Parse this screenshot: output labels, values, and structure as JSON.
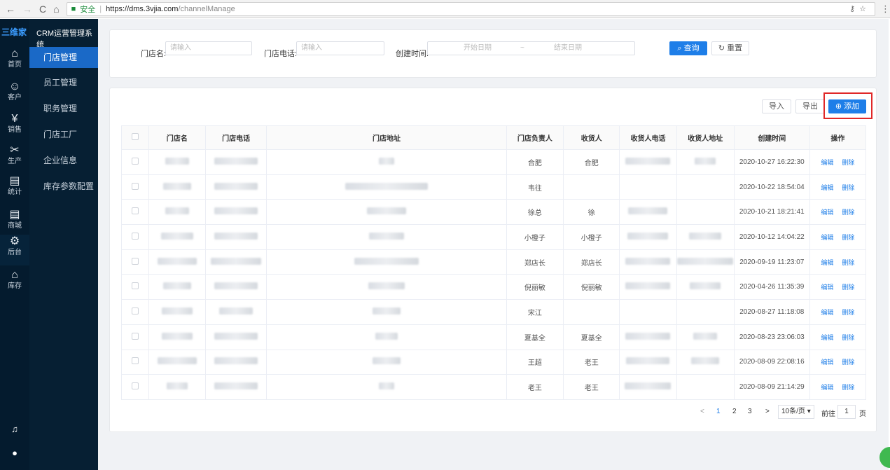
{
  "browser": {
    "secure_label": "安全",
    "url_host": "https://dms.3vjia.com",
    "url_path": "/channelManage"
  },
  "rail": {
    "logo": "三维家",
    "items": [
      {
        "icon": "home-icon",
        "label": "首页"
      },
      {
        "icon": "customer-icon",
        "label": "客户"
      },
      {
        "icon": "sales-icon",
        "label": "销售"
      },
      {
        "icon": "production-icon",
        "label": "生产"
      },
      {
        "icon": "stats-icon",
        "label": "统计"
      },
      {
        "icon": "mall-icon",
        "label": "商城"
      },
      {
        "icon": "backend-icon",
        "label": "后台"
      },
      {
        "icon": "warehouse-icon",
        "label": "库存"
      }
    ]
  },
  "sidebar": {
    "title": "CRM运营管理系统",
    "items": [
      {
        "label": "门店管理"
      },
      {
        "label": "员工管理"
      },
      {
        "label": "职务管理"
      },
      {
        "label": "门店工厂"
      },
      {
        "label": "企业信息"
      },
      {
        "label": "库存参数配置"
      }
    ]
  },
  "filter": {
    "store_name_label": "门店名:",
    "store_name_placeholder": "请输入",
    "store_phone_label": "门店电话:",
    "store_phone_placeholder": "请输入",
    "created_label": "创建时间:",
    "start_placeholder": "开始日期",
    "range_sep": "~",
    "end_placeholder": "结束日期",
    "search_label": "查询",
    "reset_label": "重置"
  },
  "toolbar": {
    "import_label": "导入",
    "export_label": "导出",
    "add_label": "添加"
  },
  "table": {
    "headers": [
      "门店名",
      "门店电话",
      "门店地址",
      "门店负责人",
      "收货人",
      "收货人电话",
      "收货人地址",
      "创建时间",
      "操作"
    ],
    "edit_label": "编辑",
    "delete_label": "删除",
    "rows": [
      {
        "manager": "合肥",
        "receiver": "合肥",
        "created": "2020-10-27 16:22:30"
      },
      {
        "manager": "韦往",
        "receiver": "",
        "created": "2020-10-22 18:54:04"
      },
      {
        "manager": "徐总",
        "receiver": "徐",
        "created": "2020-10-21 18:21:41"
      },
      {
        "manager": "小橙子",
        "receiver": "小橙子",
        "created": "2020-10-12 14:04:22"
      },
      {
        "manager": "郑店长",
        "receiver": "郑店长",
        "created": "2020-09-19 11:23:07"
      },
      {
        "manager": "倪丽敏",
        "receiver": "倪丽敏",
        "created": "2020-04-26 11:35:39"
      },
      {
        "manager": "宋江",
        "receiver": "",
        "created": "2020-08-27 11:18:08"
      },
      {
        "manager": "夏基全",
        "receiver": "夏基全",
        "created": "2020-08-23 23:06:03"
      },
      {
        "manager": "王超",
        "receiver": "老王",
        "created": "2020-08-09 22:08:16"
      },
      {
        "manager": "老王",
        "receiver": "老王",
        "created": "2020-08-09 21:14:29"
      }
    ]
  },
  "pagination": {
    "prev": "<",
    "pages": [
      "1",
      "2",
      "3"
    ],
    "next": ">",
    "page_size": "10条/页",
    "goto_label": "前往",
    "goto_value": "1",
    "page_suffix": "页"
  }
}
